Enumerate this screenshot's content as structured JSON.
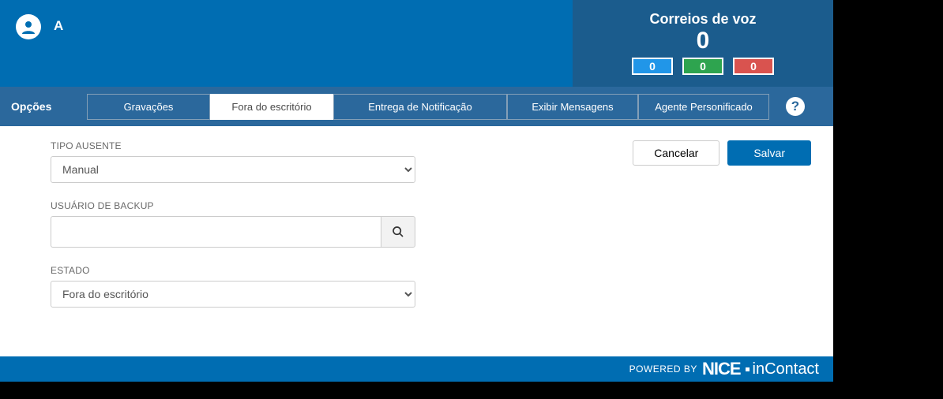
{
  "header": {
    "user_initial": "A",
    "voicemail_title": "Correios de voz",
    "voicemail_count": "0",
    "counters": {
      "blue": "0",
      "green": "0",
      "red": "0"
    }
  },
  "nav": {
    "label": "Opções",
    "tabs": {
      "recordings": "Gravações",
      "out_of_office": "Fora do escritório",
      "notification_delivery": "Entrega de Notificação",
      "show_messages": "Exibir Mensagens",
      "impersonated_agent": "Agente Personificado"
    },
    "help": "?"
  },
  "actions": {
    "cancel": "Cancelar",
    "save": "Salvar"
  },
  "form": {
    "absence_type": {
      "label": "TIPO AUSENTE",
      "value": "Manual"
    },
    "backup_user": {
      "label": "USUÁRIO DE BACKUP",
      "value": ""
    },
    "state": {
      "label": "ESTADO",
      "value": "Fora do escritório"
    }
  },
  "footer": {
    "powered_by": "POWERED BY",
    "brand_nice": "NICE",
    "brand_incontact": "inContact"
  }
}
